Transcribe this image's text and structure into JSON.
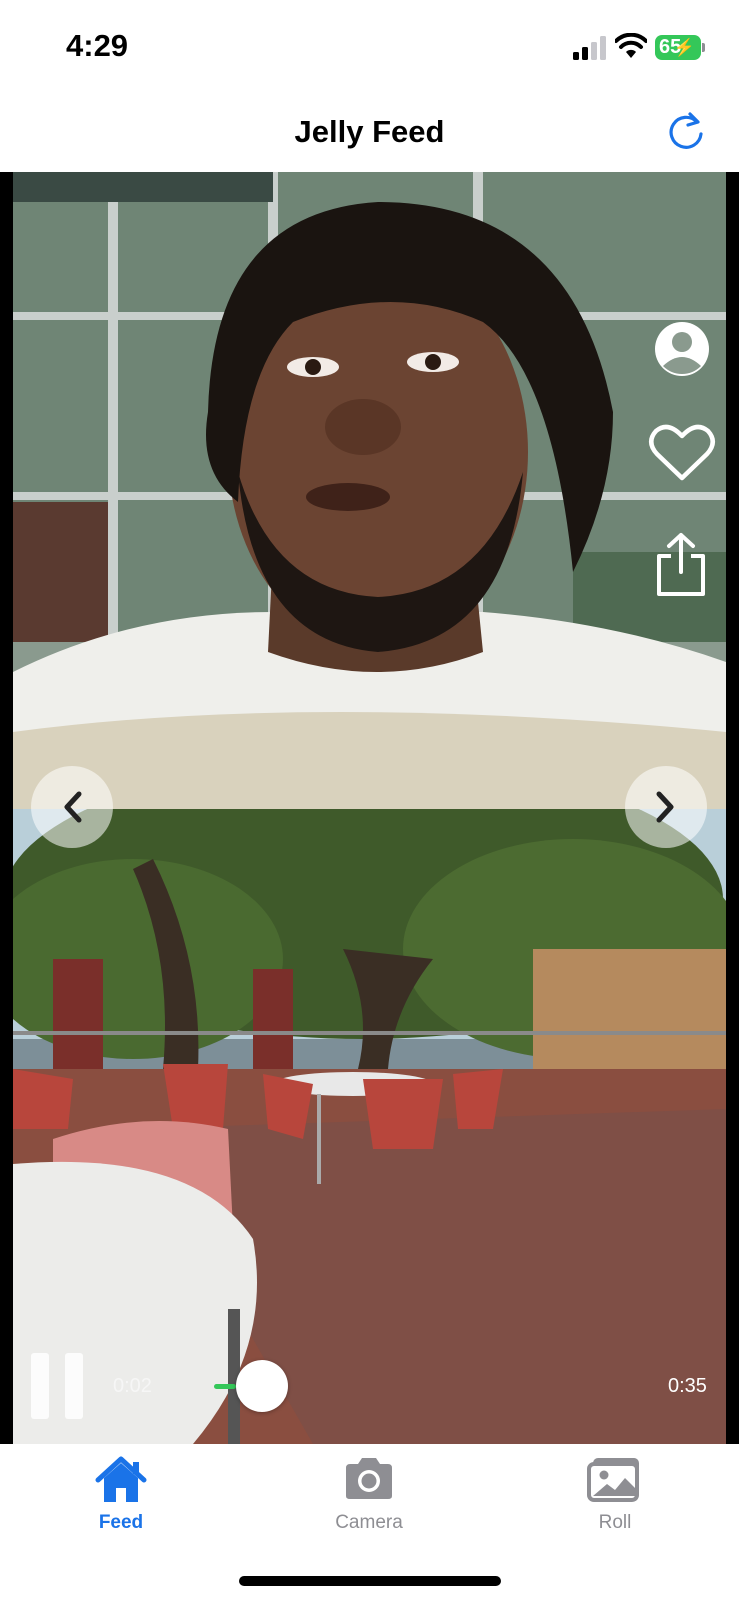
{
  "status_bar": {
    "time": "4:29",
    "battery": "65",
    "battery_icon": "battery-charging-icon",
    "signal_icon": "cellular-signal-icon",
    "wifi_icon": "wifi-icon"
  },
  "nav": {
    "title": "Jelly Feed",
    "refresh_icon": "refresh-icon"
  },
  "side_actions": [
    "profile-icon",
    "heart-icon",
    "share-icon"
  ],
  "player": {
    "current_time": "0:02",
    "total_time": "0:35",
    "progress_fraction": 0.057
  },
  "tabs": [
    {
      "label": "Feed",
      "icon": "house-icon",
      "active": true
    },
    {
      "label": "Camera",
      "icon": "camera-icon",
      "active": false
    },
    {
      "label": "Roll",
      "icon": "photos-icon",
      "active": false
    }
  ],
  "colors": {
    "accent": "#1a73e8",
    "inactive": "#8e8e93",
    "progress": "#34c759",
    "battery": "#34c759"
  }
}
